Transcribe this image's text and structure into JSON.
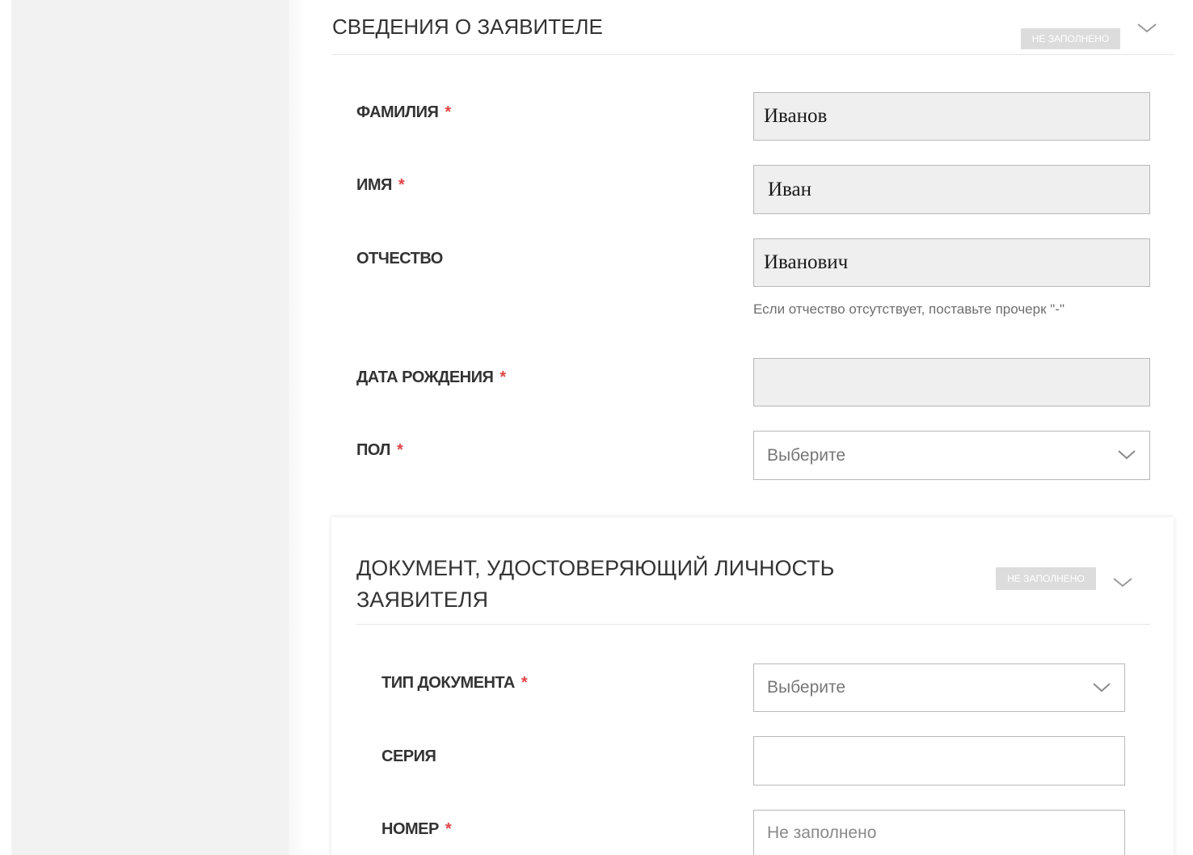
{
  "applicant": {
    "title": "СВЕДЕНИЯ О ЗАЯВИТЕЛЕ",
    "status": "НЕ ЗАПОЛНЕНО",
    "fields": {
      "surname": {
        "label": "ФАМИЛИЯ",
        "required": "*",
        "value": "Иванов"
      },
      "name": {
        "label": "ИМЯ",
        "required": "*",
        "value": "Иван"
      },
      "patronymic": {
        "label": "ОТЧЕСТВО",
        "value": "Иванович",
        "hint": "Если отчество отсутствует, поставьте прочерк \"-\""
      },
      "birth_date": {
        "label": "ДАТА РОЖДЕНИЯ",
        "required": "*",
        "value": ""
      },
      "gender": {
        "label": "ПОЛ",
        "required": "*",
        "selected": "Выберите"
      }
    }
  },
  "identity_document": {
    "title_line1": "ДОКУМЕНТ, УДОСТОВЕРЯЮЩИЙ ЛИЧНОСТЬ",
    "title_line2": "ЗАЯВИТЕЛЯ",
    "status": "НЕ ЗАПОЛНЕНО",
    "fields": {
      "doc_type": {
        "label": "ТИП ДОКУМЕНТА",
        "required": "*",
        "selected": "Выберите"
      },
      "series": {
        "label": "СЕРИЯ",
        "value": ""
      },
      "number": {
        "label": "НОМЕР",
        "required": "*",
        "placeholder": "Не заполнено"
      }
    }
  },
  "colors": {
    "required_mark": "#e04545",
    "badge_bg": "#dcdcdc",
    "filled_input_bg": "#efefef",
    "border": "#b8b8b8"
  },
  "icons": {
    "expand": "chevron-down-icon"
  }
}
